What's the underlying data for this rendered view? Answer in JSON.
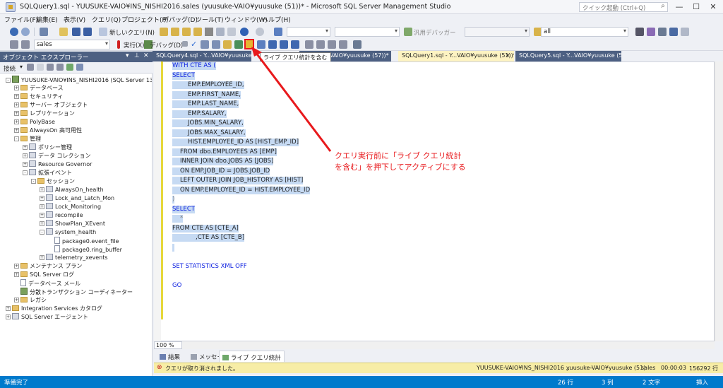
{
  "titlebar": {
    "title": "SQLQuery1.sql - YUUSUKE-VAIO¥INS_NISHI2016.sales (yuusuke-VAIO¥yuusuke (51))* - Microsoft SQL Server Management Studio",
    "quick_launch": "クイック起動 (Ctrl+Q)"
  },
  "menu": [
    "ファイル(F)",
    "編集(E)",
    "表示(V)",
    "クエリ(Q)",
    "プロジェクト(P)",
    "デバッグ(D)",
    "ツール(T)",
    "ウィンドウ(W)",
    "ヘルプ(H)"
  ],
  "toolbar1": {
    "new_query": "新しいクエリ(N)",
    "general_debugger": "汎用デバッガー",
    "solution": "all"
  },
  "toolbar2": {
    "database": "sales",
    "execute": "実行(X)",
    "debug": "デバッグ(D)"
  },
  "tooltip": "ライブ クエリ統計を含む",
  "object_explorer": {
    "title": "オブジェクト エクスプローラー",
    "connect": "接続",
    "nodes": [
      {
        "label": "YUUSUKE-VAIO¥INS_NISHI2016 (SQL Server 13.0.16",
        "level": 0,
        "exp": "-",
        "icon": "server"
      },
      {
        "label": "データベース",
        "level": 1,
        "exp": "+",
        "icon": "folder"
      },
      {
        "label": "セキュリティ",
        "level": 1,
        "exp": "+",
        "icon": "folder"
      },
      {
        "label": "サーバー オブジェクト",
        "level": 1,
        "exp": "+",
        "icon": "folder"
      },
      {
        "label": "レプリケーション",
        "level": 1,
        "exp": "+",
        "icon": "folder"
      },
      {
        "label": "PolyBase",
        "level": 1,
        "exp": "+",
        "icon": "folder"
      },
      {
        "label": "AlwaysOn 高可用性",
        "level": 1,
        "exp": "+",
        "icon": "folder"
      },
      {
        "label": "管理",
        "level": 1,
        "exp": "-",
        "icon": "folder"
      },
      {
        "label": "ポリシー管理",
        "level": 2,
        "exp": "+",
        "icon": "item"
      },
      {
        "label": "データ コレクション",
        "level": 2,
        "exp": "+",
        "icon": "item"
      },
      {
        "label": "Resource Governor",
        "level": 2,
        "exp": "+",
        "icon": "item"
      },
      {
        "label": "拡張イベント",
        "level": 2,
        "exp": "-",
        "icon": "item"
      },
      {
        "label": "セッション",
        "level": 3,
        "exp": "-",
        "icon": "folder"
      },
      {
        "label": "AlwaysOn_health",
        "level": 4,
        "exp": "+",
        "icon": "item"
      },
      {
        "label": "Lock_and_Latch_Mon",
        "level": 4,
        "exp": "+",
        "icon": "item"
      },
      {
        "label": "Lock_Monitoring",
        "level": 4,
        "exp": "+",
        "icon": "item"
      },
      {
        "label": "recompile",
        "level": 4,
        "exp": "+",
        "icon": "item"
      },
      {
        "label": "ShowPlan_XEvent",
        "level": 4,
        "exp": "+",
        "icon": "item"
      },
      {
        "label": "system_health",
        "level": 4,
        "exp": "-",
        "icon": "item"
      },
      {
        "label": "package0.event_file",
        "level": 5,
        "exp": "",
        "icon": "doc"
      },
      {
        "label": "package0.ring_buffer",
        "level": 5,
        "exp": "",
        "icon": "doc"
      },
      {
        "label": "telemetry_xevents",
        "level": 4,
        "exp": "+",
        "icon": "item"
      },
      {
        "label": "メンテナンス プラン",
        "level": 1,
        "exp": "+",
        "icon": "folder"
      },
      {
        "label": "SQL Server ログ",
        "level": 1,
        "exp": "+",
        "icon": "folder"
      },
      {
        "label": "データベース メール",
        "level": 1,
        "exp": "",
        "icon": "doc"
      },
      {
        "label": "分散トランザクション コーディネーター",
        "level": 1,
        "exp": "",
        "icon": "server"
      },
      {
        "label": "レガシ",
        "level": 1,
        "exp": "+",
        "icon": "folder"
      },
      {
        "label": "Integration Services カタログ",
        "level": 0,
        "exp": "+",
        "icon": "folder"
      },
      {
        "label": "SQL Server エージェント",
        "level": 0,
        "exp": "+",
        "icon": "item"
      }
    ]
  },
  "tabs": [
    {
      "label": "SQLQuery4.sql - Y...VAIO¥yuusuke (58",
      "active": false
    },
    {
      "label": "...sql - Y...VAIO¥yuusuke (57))*",
      "active": false
    },
    {
      "label": "SQLQuery1.sql - Y...VAIO¥yuusuke (51))*",
      "active": true
    },
    {
      "label": "SQLQuery5.sql - Y...VAIO¥yuusuke (52))*",
      "active": false
    }
  ],
  "code_lines": [
    {
      "text": "WITH CTE AS (",
      "indent": 0,
      "cls": "kw",
      "sel": true
    },
    {
      "text": "SELECT",
      "indent": 0,
      "cls": "kw",
      "sel": true
    },
    {
      "text": "EMP.EMPLOYEE_ID,",
      "indent": 2,
      "cls": "bk",
      "sel": true
    },
    {
      "text": "EMP.FIRST_NAME,",
      "indent": 2,
      "cls": "bk",
      "sel": true
    },
    {
      "text": "EMP.LAST_NAME,",
      "indent": 2,
      "cls": "bk",
      "sel": true
    },
    {
      "text": "EMP.SALARY,",
      "indent": 2,
      "cls": "bk",
      "sel": true
    },
    {
      "text": "JOBS.MIN_SALARY,",
      "indent": 2,
      "cls": "bk",
      "sel": true
    },
    {
      "text": "JOBS.MAX_SALARY,",
      "indent": 2,
      "cls": "bk",
      "sel": true
    },
    {
      "text": "HIST.EMPLOYEE_ID AS [HIST_EMP_ID]",
      "indent": 2,
      "cls": "bk",
      "sel": true
    },
    {
      "text": "FROM  dbo.EMPLOYEES AS [EMP]",
      "indent": 1,
      "cls": "bk",
      "sel": true
    },
    {
      "text": "INNER JOIN dbo.JOBS AS [JOBS]",
      "indent": 1,
      "cls": "bk",
      "sel": true
    },
    {
      "text": "ON EMP.JOB_ID = JOBS.JOB_ID",
      "indent": 1,
      "cls": "bk",
      "sel": true
    },
    {
      "text": "LEFT OUTER JOIN  JOB_HISTORY AS [HIST]",
      "indent": 1,
      "cls": "bk",
      "sel": true
    },
    {
      "text": "ON EMP.EMPLOYEE_ID = HIST.EMPLOYEE_ID",
      "indent": 1,
      "cls": "bk",
      "sel": true
    },
    {
      "text": ")",
      "indent": 0,
      "cls": "gy",
      "sel": true
    },
    {
      "text": "SELECT",
      "indent": 0,
      "cls": "kw",
      "sel": true
    },
    {
      "text": "*",
      "indent": 1,
      "cls": "gy",
      "sel": true
    },
    {
      "text": "FROM    CTE AS [CTE_A]",
      "indent": 0,
      "cls": "bk",
      "sel": true
    },
    {
      "text": ",CTE AS [CTE_B]",
      "indent": 3,
      "cls": "bk",
      "sel": true
    },
    {
      "text": "",
      "indent": 0,
      "cls": "bk",
      "sel": true
    },
    {
      "text": "",
      "indent": 0,
      "cls": "bk",
      "sel": false
    },
    {
      "text": "SET STATISTICS XML OFF",
      "indent": 0,
      "cls": "kw",
      "sel": false
    },
    {
      "text": "",
      "indent": 0,
      "cls": "bk",
      "sel": false
    },
    {
      "text": "GO",
      "indent": 0,
      "cls": "kw",
      "sel": false
    }
  ],
  "zoom": "100 %",
  "result_tabs": [
    "結果",
    "メッセージ",
    "ライブ クエリ統計"
  ],
  "query_status": {
    "message": "クエリが取り消されました。",
    "server": "YUUSUKE-VAIO¥INS_NISHI2016 ...",
    "user": "yuusuke-VAIO¥yuusuke (51)",
    "db": "sales",
    "time": "00:00:03",
    "rows": "156292 行"
  },
  "statusbar": {
    "ready": "準備完了",
    "line": "26 行",
    "col": "3 列",
    "ch": "2 文字",
    "mode": "挿入"
  },
  "annotation": "クエリ実行前に「ライブ クエリ統計\nを含む」を押下してアクティブにする",
  "colors": {
    "accent": "#007acc",
    "callout": "#e8191c",
    "selection": "#c6daf3",
    "keyword": "#0a1de0"
  }
}
